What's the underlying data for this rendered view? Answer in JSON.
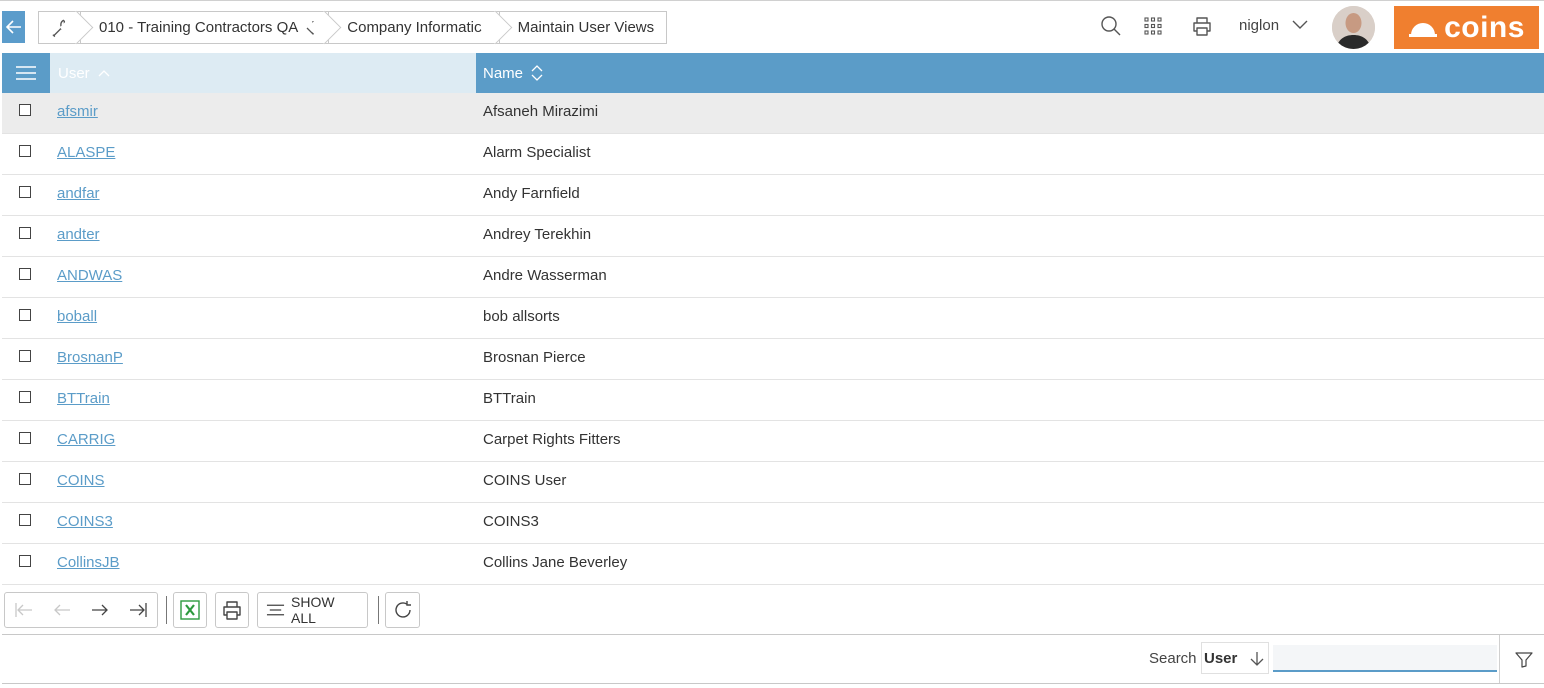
{
  "header": {
    "breadcrumbs": [
      {
        "label": "010 - Training Contractors QA"
      },
      {
        "label": "Company Information"
      },
      {
        "label": "Maintain User Views"
      }
    ],
    "username": "niglon",
    "logo_text": "coins",
    "icons": {
      "back": "arrow-left-icon",
      "tool": "wrench-icon",
      "search": "search-icon",
      "apps": "grid-icon",
      "print": "printer-icon",
      "user_menu": "chevron-down-icon"
    }
  },
  "grid": {
    "columns": [
      {
        "label": "User",
        "sort": "ascending"
      },
      {
        "label": "Name",
        "sort": "none"
      }
    ],
    "rows": [
      {
        "user": "afsmir",
        "name": "Afsaneh Mirazimi",
        "highlighted": true
      },
      {
        "user": "ALASPE",
        "name": "Alarm Specialist"
      },
      {
        "user": "andfar",
        "name": "Andy Farnfield"
      },
      {
        "user": "andter",
        "name": "Andrey Terekhin"
      },
      {
        "user": "ANDWAS",
        "name": "Andre Wasserman"
      },
      {
        "user": "boball",
        "name": "bob allsorts"
      },
      {
        "user": "BrosnanP",
        "name": "Brosnan Pierce"
      },
      {
        "user": "BTTrain",
        "name": "BTTrain"
      },
      {
        "user": "CARRIG",
        "name": "Carpet Rights Fitters"
      },
      {
        "user": "COINS",
        "name": "COINS User"
      },
      {
        "user": "COINS3",
        "name": "COINS3"
      },
      {
        "user": "CollinsJB",
        "name": "Collins Jane Beverley"
      }
    ]
  },
  "toolbar": {
    "show_all_label": "SHOW ALL",
    "icons": [
      "first-page-icon",
      "previous-page-icon",
      "next-page-icon",
      "last-page-icon",
      "excel-export-icon",
      "print-icon",
      "show-all-icon",
      "refresh-icon"
    ]
  },
  "search": {
    "label": "Search",
    "field": "User",
    "value": ""
  },
  "colors": {
    "accent": "#5b9cc8",
    "brand": "#f07f2f",
    "link": "#5b9cc8",
    "row_highlight": "#ececec"
  }
}
